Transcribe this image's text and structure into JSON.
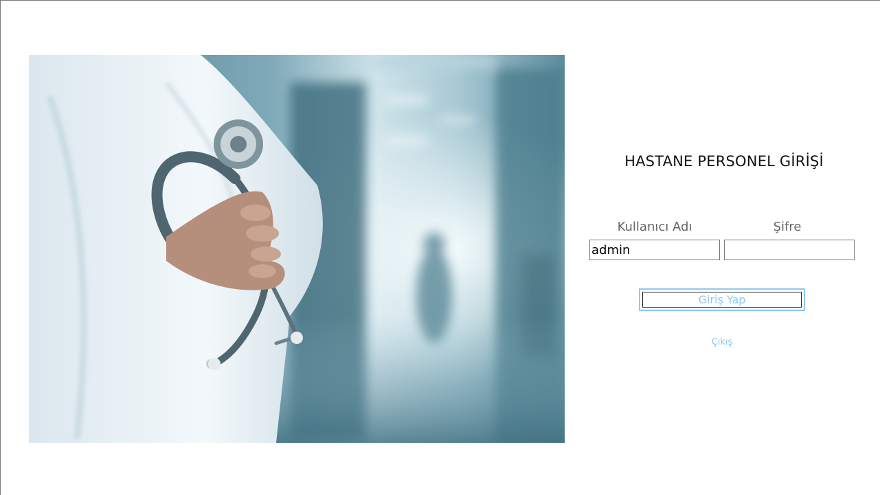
{
  "login": {
    "title": "HASTANE PERSONEL GİRİŞİ",
    "username_label": "Kullanıcı Adı",
    "password_label": "Şifre",
    "username_value": "admin",
    "password_value": "",
    "login_button_label": "Giriş Yap",
    "exit_label": "Çıkış"
  },
  "colors": {
    "accent": "#8fc8ee",
    "title_text": "#111111",
    "label_text": "#666666",
    "field_border": "#7a7a7a"
  },
  "image": {
    "subject": "doctor-with-stethoscope-hospital-corridor"
  }
}
